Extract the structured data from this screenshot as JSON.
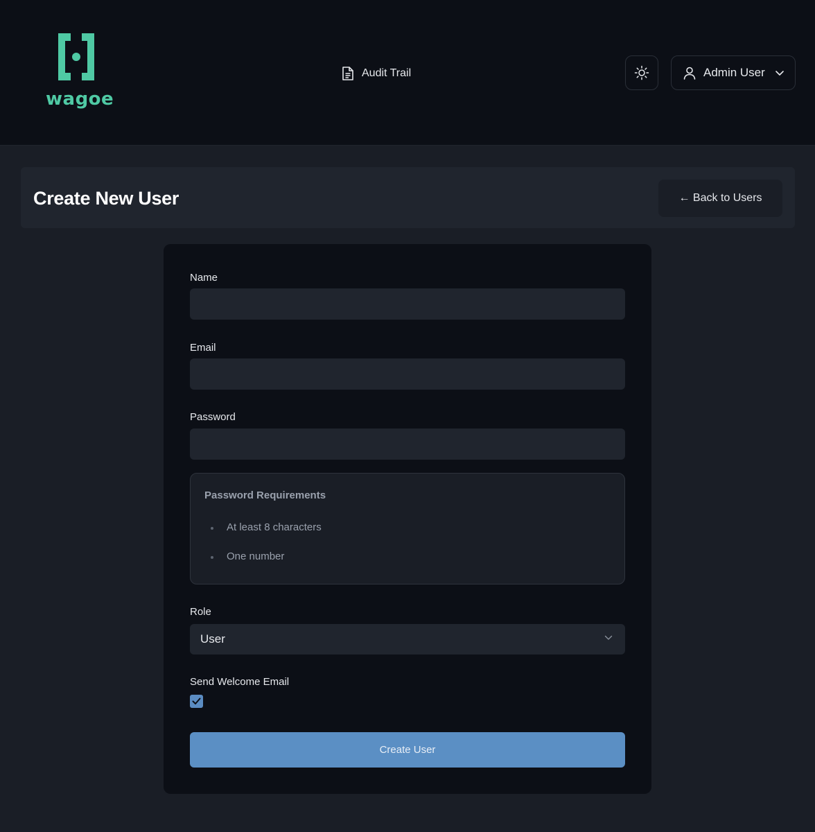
{
  "header": {
    "logo_text": "wagoe",
    "nav": {
      "audit_trail_label": "Audit Trail"
    },
    "theme_toggle_icon": "sun-icon",
    "user_menu": {
      "label": "Admin User"
    }
  },
  "page": {
    "title": "Create New User",
    "back_button_label": "← Back to Users"
  },
  "form": {
    "name_label": "Name",
    "name_value": "",
    "email_label": "Email",
    "email_value": "",
    "password_label": "Password",
    "password_value": "",
    "requirements": {
      "title": "Password Requirements",
      "items": [
        "At least 8 characters",
        "One number"
      ]
    },
    "role_label": "Role",
    "role_selected": "User",
    "welcome_email_label": "Send Welcome Email",
    "welcome_email_checked": true,
    "submit_label": "Create User"
  },
  "colors": {
    "brand": "#4fc9a4",
    "primary_button": "#5b8fc4",
    "background": "#1a1e26",
    "topbar": "#0c0f16"
  }
}
